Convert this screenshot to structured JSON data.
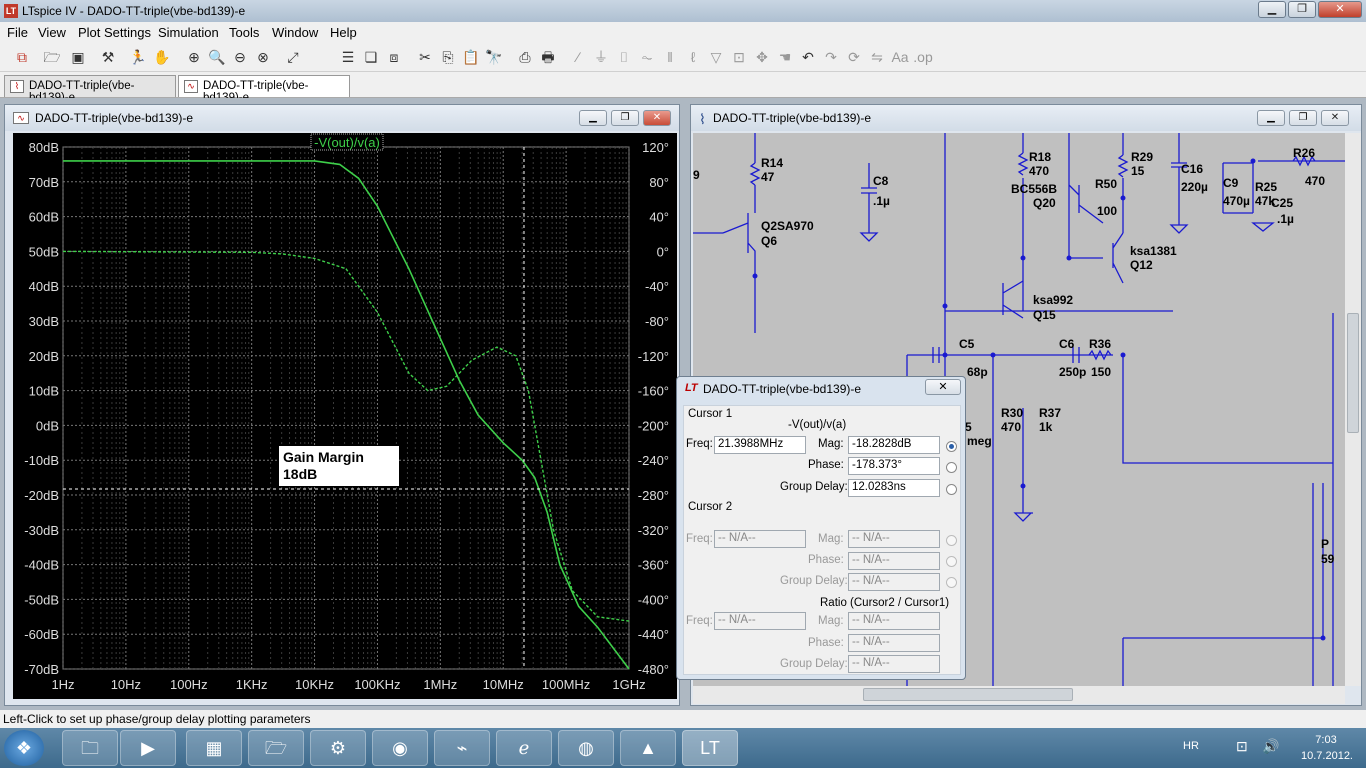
{
  "app": {
    "title": "LTspice IV - DADO-TT-triple(vbe-bd139)-e",
    "icon": "ltspice-icon"
  },
  "window_controls": {
    "minimize": "▁",
    "restore": "❐",
    "close": "✕"
  },
  "menu": [
    "File",
    "View",
    "Plot Settings",
    "Simulation",
    "Tools",
    "Window",
    "Help"
  ],
  "tabs": [
    {
      "label": "DADO-TT-triple(vbe-bd139)-e",
      "icon": "schematic-icon"
    },
    {
      "label": "DADO-TT-triple(vbe-bd139)-e",
      "icon": "waveform-icon"
    }
  ],
  "plot_window": {
    "title": "DADO-TT-triple(vbe-bd139)-e",
    "trace_label": "-V(out)/v(a)",
    "annotation_line1": "Gain Margin",
    "annotation_line2": "18dB"
  },
  "schematic_window": {
    "title": "DADO-TT-triple(vbe-bd139)-e"
  },
  "schematic_labels": [
    "R14",
    "47",
    "Q2SA970",
    "Q6",
    "C8",
    ".1µ",
    "R18",
    "470",
    "BC556B",
    "Q20",
    "R50",
    "100",
    "R29",
    "15",
    "C16",
    "220µ",
    "C9",
    "470µ",
    "R25",
    "47k",
    "C25",
    ".1µ",
    "R26",
    "470",
    "ksa1381",
    "Q12",
    "ksa992",
    "Q15",
    "C5",
    "68p",
    "C6",
    "250p",
    "R36",
    "150",
    "R30",
    "470",
    "R37",
    "1k",
    "5",
    "meg",
    "P",
    "59",
    "9"
  ],
  "chart_data": {
    "type": "line",
    "title": "-V(out)/v(a)",
    "x_ticks": [
      "1Hz",
      "10Hz",
      "100Hz",
      "1KHz",
      "10KHz",
      "100KHz",
      "1MHz",
      "10MHz",
      "100MHz",
      "1GHz"
    ],
    "y_left_ticks": [
      "80dB",
      "70dB",
      "60dB",
      "50dB",
      "40dB",
      "30dB",
      "20dB",
      "10dB",
      "0dB",
      "-10dB",
      "-20dB",
      "-30dB",
      "-40dB",
      "-50dB",
      "-60dB",
      "-70dB"
    ],
    "y_right_ticks": [
      "120°",
      "80°",
      "40°",
      "0°",
      "-40°",
      "-80°",
      "-120°",
      "-160°",
      "-200°",
      "-240°",
      "-280°",
      "-320°",
      "-360°",
      "-400°",
      "-440°",
      "-480°"
    ],
    "xlim_log10": [
      0,
      9
    ],
    "ylim_db": [
      -70,
      80
    ],
    "ylim_deg": [
      -480,
      120
    ],
    "grid": true,
    "series": [
      {
        "name": "magnitude",
        "style": "solid",
        "color": "#3ecf4a",
        "points": [
          [
            0,
            76
          ],
          [
            3,
            76
          ],
          [
            4,
            76
          ],
          [
            4.4,
            75
          ],
          [
            4.7,
            71
          ],
          [
            5,
            63
          ],
          [
            5.5,
            45
          ],
          [
            6,
            25
          ],
          [
            6.3,
            13
          ],
          [
            6.6,
            3
          ],
          [
            7,
            -5
          ],
          [
            7.3,
            -10
          ],
          [
            7.5,
            -15
          ],
          [
            7.7,
            -25
          ],
          [
            7.9,
            -40
          ],
          [
            8.2,
            -52
          ],
          [
            8.5,
            -58
          ],
          [
            9,
            -70
          ]
        ]
      },
      {
        "name": "phase",
        "style": "dashed",
        "color": "#3ecf4a",
        "points": [
          [
            0,
            0
          ],
          [
            3,
            -1
          ],
          [
            3.5,
            -3
          ],
          [
            4,
            -8
          ],
          [
            4.5,
            -20
          ],
          [
            5,
            -70
          ],
          [
            5.5,
            -140
          ],
          [
            5.8,
            -160
          ],
          [
            6.1,
            -155
          ],
          [
            6.5,
            -125
          ],
          [
            6.9,
            -110
          ],
          [
            7.2,
            -120
          ],
          [
            7.4,
            -160
          ],
          [
            7.6,
            -240
          ],
          [
            7.8,
            -320
          ],
          [
            8.1,
            -390
          ],
          [
            8.5,
            -420
          ],
          [
            9,
            -425
          ]
        ]
      }
    ],
    "cursor_x_log10": 7.33,
    "cursor_y_db": -18.28
  },
  "cursor_dialog": {
    "title": "DADO-TT-triple(vbe-bd139)-e",
    "cursor1_label": "Cursor 1",
    "expr": "-V(out)/v(a)",
    "freq_label": "Freq:",
    "freq": "21.3988MHz",
    "mag_label": "Mag:",
    "mag": "-18.2828dB",
    "phase_label": "Phase:",
    "phase": "-178.373°",
    "gd_label": "Group Delay:",
    "gd": "12.0283ns",
    "cursor2_label": "Cursor 2",
    "na": "-- N/A--",
    "ratio_label": "Ratio (Cursor2 / Cursor1)"
  },
  "status": {
    "text": "Left-Click to set up phase/group delay plotting parameters"
  },
  "tray": {
    "lang": "HR",
    "time": "7:03",
    "date": "10.7.2012."
  }
}
